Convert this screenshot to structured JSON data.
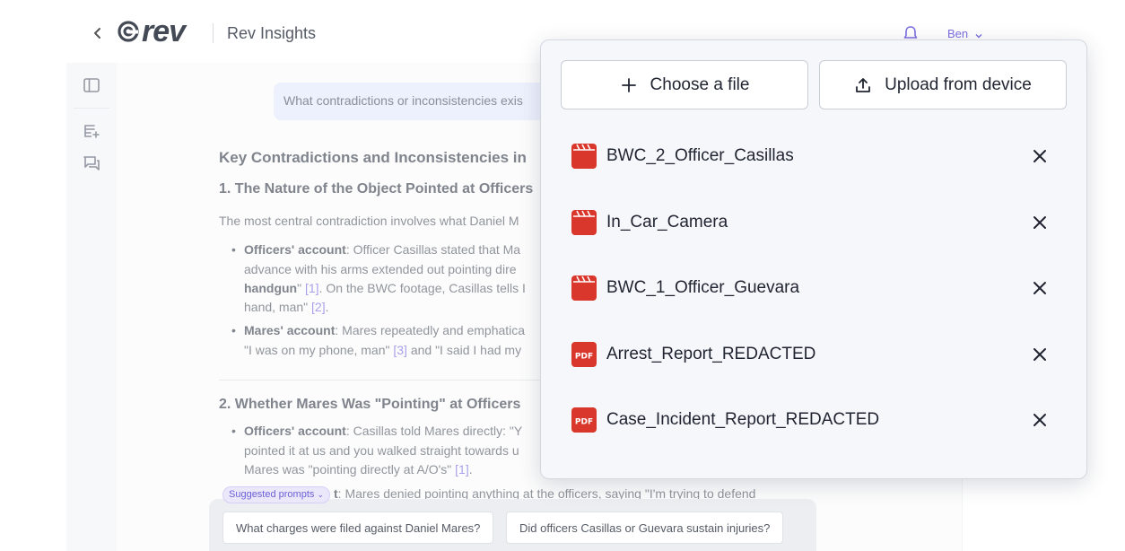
{
  "header": {
    "logo_text": "rev",
    "app_title": "Rev Insights",
    "user_name": "Ben"
  },
  "chat": {
    "user_question": "What contradictions or inconsistencies exis",
    "heading": "Key Contradictions and Inconsistencies in",
    "section1_title": "1. The Nature of the Object Pointed at Officers",
    "section1_intro": "The most central contradiction involves what Daniel M",
    "s1_b1_label": "Officers' account",
    "s1_b1_l1": ": Officer Casillas stated that Ma",
    "s1_b1_l2": "advance with his arms extended out pointing dire",
    "s1_b1_l3_bold": "handgun",
    "s1_b1_l3a": "\" ",
    "s1_b1_cite1": "[1]",
    "s1_b1_l3b": ". On the BWC footage, Casillas tells I",
    "s1_b1_l4": "hand, man\" ",
    "s1_b1_cite2": "[2]",
    "s1_b1_l4end": ".",
    "s1_b2_label": "Mares' account",
    "s1_b2_l1": ": Mares repeatedly and emphatica",
    "s1_b2_l2a": "\"I was on my phone, man\" ",
    "s1_b2_cite": "[3]",
    "s1_b2_l2b": " and \"I said I had my",
    "section2_title": "2. Whether Mares Was \"Pointing\" at Officers",
    "s2_b1_label": "Officers' account",
    "s2_b1_l1": ": Casillas told Mares directly: \"Y",
    "s2_b1_l2": "pointed it at us and you walked straight towards u",
    "s2_b1_l3a": "Mares was \"pointing directly at A/O's\" ",
    "s2_b1_cite": "[1]",
    "s2_b1_l3end": ".",
    "s2_b2_partial_bold": "t",
    "s2_b2_text": ": Mares denied pointing anything at the officers, saying \"I'm trying to defend"
  },
  "suggested": {
    "tag": "Suggested prompts",
    "prompts": [
      "What charges were filed against Daniel Mares?",
      "Did officers Casillas or Guevara sustain injuries?"
    ]
  },
  "popup": {
    "choose_label": "Choose a file",
    "upload_label": "Upload from device",
    "files": [
      {
        "name": "BWC_2_Officer_Casillas",
        "type": "video"
      },
      {
        "name": "In_Car_Camera",
        "type": "video"
      },
      {
        "name": "BWC_1_Officer_Guevara",
        "type": "video"
      },
      {
        "name": "Arrest_Report_REDACTED",
        "type": "pdf"
      },
      {
        "name": "Case_Incident_Report_REDACTED",
        "type": "pdf"
      }
    ],
    "pdf_badge": "PDF"
  },
  "colors": {
    "accent": "#7a6ee0",
    "file_icon_red": "#d9372b"
  }
}
